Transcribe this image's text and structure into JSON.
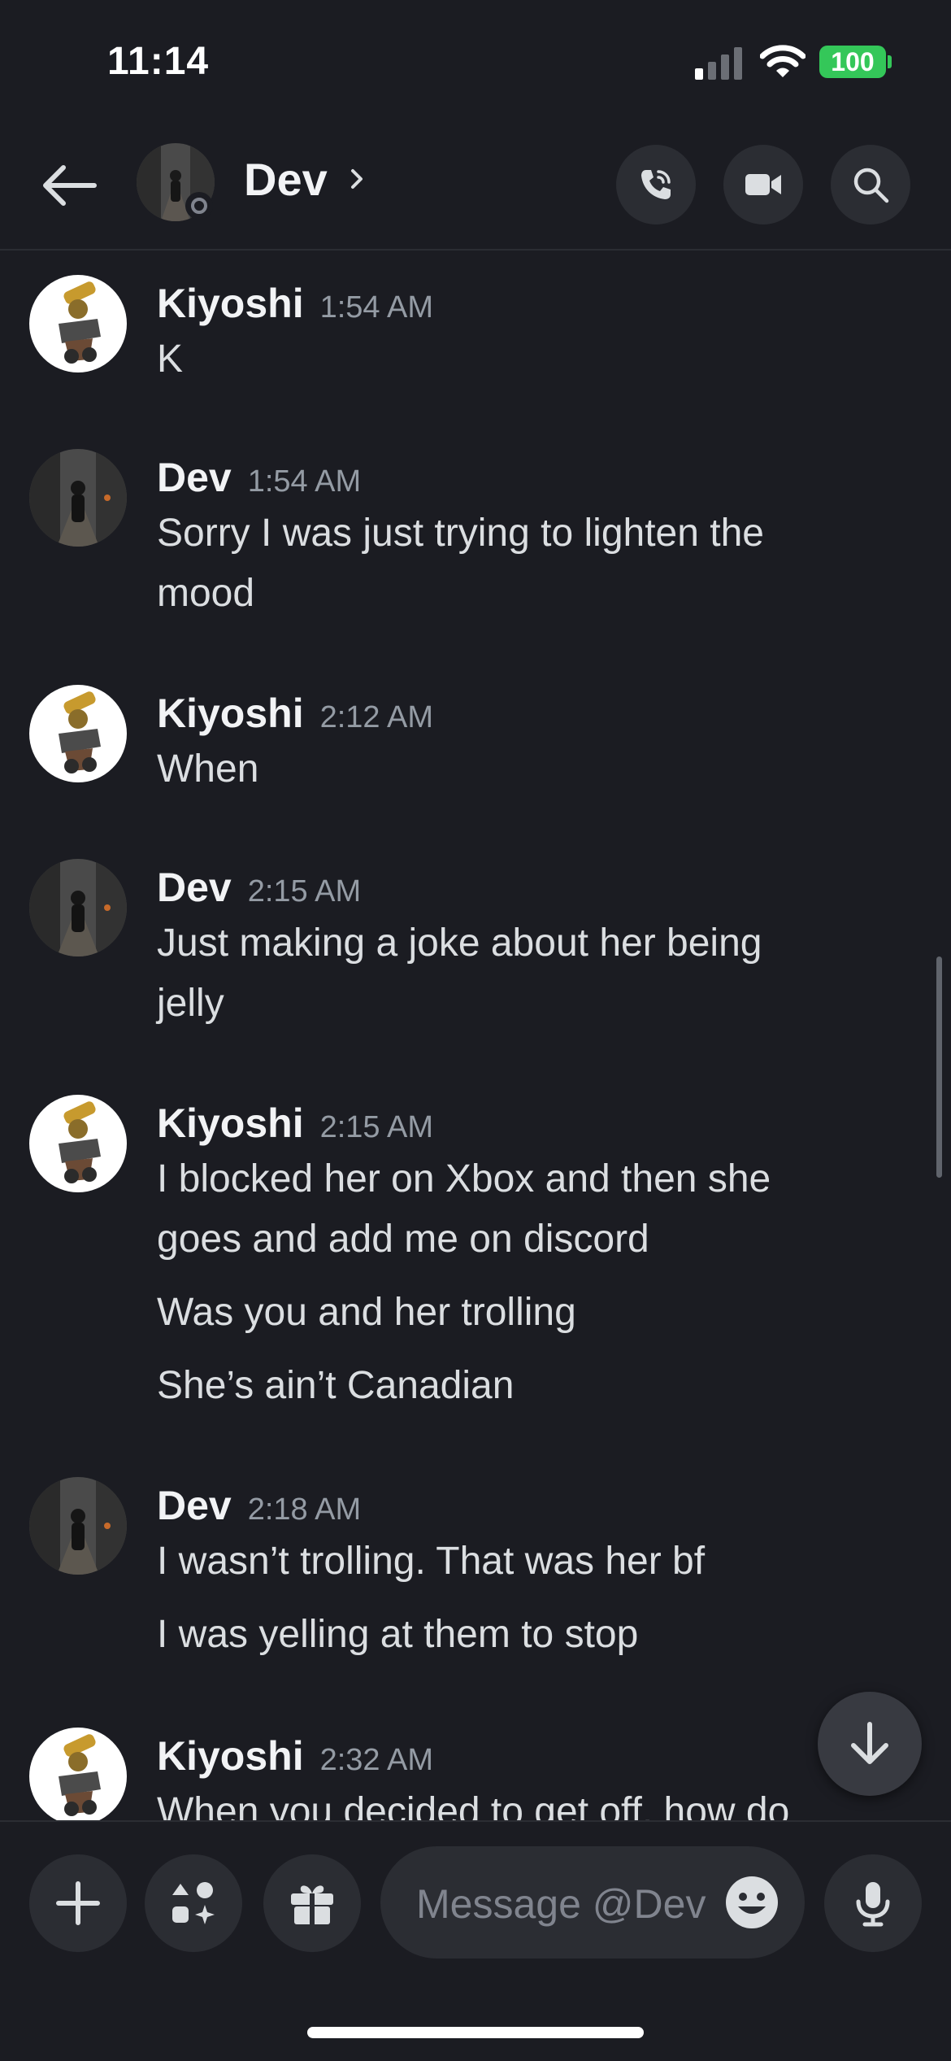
{
  "status_bar": {
    "time": "11:14",
    "battery": "100"
  },
  "header": {
    "title": "Dev",
    "chevron": "›",
    "status": "offline"
  },
  "messages": [
    {
      "author": "Kiyoshi",
      "time": "1:54 AM",
      "lines": [
        "K"
      ]
    },
    {
      "author": "Dev",
      "time": "1:54 AM",
      "lines": [
        "Sorry I was just trying to lighten the",
        "mood"
      ]
    },
    {
      "author": "Kiyoshi",
      "time": "2:12 AM",
      "lines": [
        "When"
      ]
    },
    {
      "author": "Dev",
      "time": "2:15 AM",
      "lines": [
        "Just making a joke about her being",
        "jelly"
      ]
    },
    {
      "author": "Kiyoshi",
      "time": "2:15 AM",
      "lines": [
        "I blocked her on Xbox and then she",
        "goes and add me on discord",
        "Was you and her trolling",
        "She’s ain’t Canadian"
      ]
    },
    {
      "author": "Dev",
      "time": "2:18 AM",
      "lines": [
        "I wasn’t trolling. That was her bf",
        "I was yelling at them to stop"
      ]
    },
    {
      "author": "Kiyoshi",
      "time": "2:32 AM",
      "lines": [
        "When you decided to get off, how do"
      ]
    }
  ],
  "composer": {
    "placeholder": "Message @Dev"
  },
  "icons": {
    "back": "arrow-left-icon",
    "call": "phone-icon",
    "video": "video-camera-icon",
    "search": "search-icon",
    "jump": "arrow-down-icon",
    "plus": "plus-icon",
    "apps": "apps-icon",
    "gift": "gift-icon",
    "emoji": "emoji-icon",
    "mic": "microphone-icon"
  },
  "colors": {
    "background": "#1b1c22",
    "surface": "#2b2d33",
    "text": "#dbdee1",
    "muted": "#949ba4",
    "battery": "#34c759"
  }
}
